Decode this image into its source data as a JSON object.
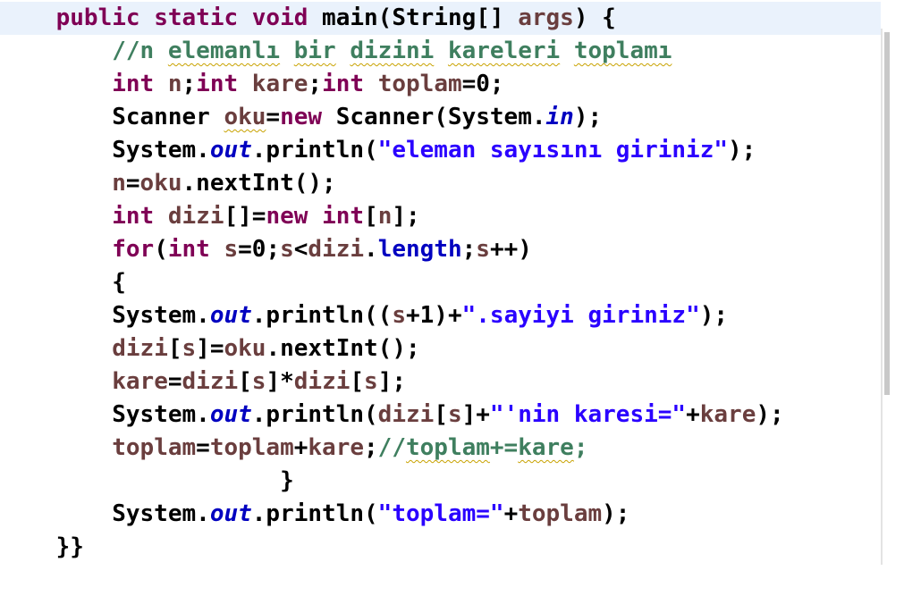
{
  "editor": {
    "lines": [
      [
        {
          "t": "    "
        },
        {
          "t": "public",
          "c": "kw"
        },
        {
          "t": " "
        },
        {
          "t": "static",
          "c": "kw"
        },
        {
          "t": " "
        },
        {
          "t": "void",
          "c": "kw"
        },
        {
          "t": " main(String[] "
        },
        {
          "t": "args",
          "c": "id"
        },
        {
          "t": ") {"
        }
      ],
      [
        {
          "t": "        "
        },
        {
          "t": "//n ",
          "c": "cmt"
        },
        {
          "t": "elemanlı",
          "c": "cmt sq"
        },
        {
          "t": " ",
          "c": "cmt"
        },
        {
          "t": "bir",
          "c": "cmt sq"
        },
        {
          "t": " ",
          "c": "cmt"
        },
        {
          "t": "dizini",
          "c": "cmt sq"
        },
        {
          "t": " ",
          "c": "cmt"
        },
        {
          "t": "kareleri",
          "c": "cmt sq"
        },
        {
          "t": " ",
          "c": "cmt"
        },
        {
          "t": "toplamı",
          "c": "cmt sq"
        }
      ],
      [
        {
          "t": "        "
        },
        {
          "t": "int",
          "c": "kw"
        },
        {
          "t": " "
        },
        {
          "t": "n",
          "c": "id"
        },
        {
          "t": ";"
        },
        {
          "t": "int",
          "c": "kw"
        },
        {
          "t": " "
        },
        {
          "t": "kare",
          "c": "id"
        },
        {
          "t": ";"
        },
        {
          "t": "int",
          "c": "kw"
        },
        {
          "t": " "
        },
        {
          "t": "toplam",
          "c": "id"
        },
        {
          "t": "=0;"
        }
      ],
      [
        {
          "t": "        Scanner "
        },
        {
          "t": "oku",
          "c": "id sq"
        },
        {
          "t": "="
        },
        {
          "t": "new",
          "c": "kw"
        },
        {
          "t": " Scanner(System."
        },
        {
          "t": "in",
          "c": "fld"
        },
        {
          "t": ");"
        }
      ],
      [
        {
          "t": "        System."
        },
        {
          "t": "out",
          "c": "fld"
        },
        {
          "t": ".println("
        },
        {
          "t": "\"eleman sayısını giriniz\"",
          "c": "str"
        },
        {
          "t": ");"
        }
      ],
      [
        {
          "t": "        "
        },
        {
          "t": "n",
          "c": "id"
        },
        {
          "t": "="
        },
        {
          "t": "oku",
          "c": "id"
        },
        {
          "t": ".nextInt();"
        }
      ],
      [
        {
          "t": "        "
        },
        {
          "t": "int",
          "c": "kw"
        },
        {
          "t": " "
        },
        {
          "t": "dizi",
          "c": "id"
        },
        {
          "t": "[]="
        },
        {
          "t": "new",
          "c": "kw"
        },
        {
          "t": " "
        },
        {
          "t": "int",
          "c": "kw"
        },
        {
          "t": "["
        },
        {
          "t": "n",
          "c": "id"
        },
        {
          "t": "];"
        }
      ],
      [
        {
          "t": "        "
        },
        {
          "t": "for",
          "c": "kw"
        },
        {
          "t": "("
        },
        {
          "t": "int",
          "c": "kw"
        },
        {
          "t": " "
        },
        {
          "t": "s",
          "c": "id"
        },
        {
          "t": "=0;"
        },
        {
          "t": "s",
          "c": "id"
        },
        {
          "t": "<"
        },
        {
          "t": "dizi",
          "c": "id"
        },
        {
          "t": "."
        },
        {
          "t": "length",
          "c": "fld2"
        },
        {
          "t": ";"
        },
        {
          "t": "s",
          "c": "id"
        },
        {
          "t": "++)"
        }
      ],
      [
        {
          "t": "        {"
        }
      ],
      [
        {
          "t": "        System."
        },
        {
          "t": "out",
          "c": "fld"
        },
        {
          "t": ".println(("
        },
        {
          "t": "s",
          "c": "id"
        },
        {
          "t": "+1)+"
        },
        {
          "t": "\".sayiyi giriniz\"",
          "c": "str"
        },
        {
          "t": ");"
        }
      ],
      [
        {
          "t": "        "
        },
        {
          "t": "dizi",
          "c": "id"
        },
        {
          "t": "["
        },
        {
          "t": "s",
          "c": "id"
        },
        {
          "t": "]="
        },
        {
          "t": "oku",
          "c": "id"
        },
        {
          "t": ".nextInt();"
        }
      ],
      [
        {
          "t": "        "
        },
        {
          "t": "kare",
          "c": "id"
        },
        {
          "t": "="
        },
        {
          "t": "dizi",
          "c": "id"
        },
        {
          "t": "["
        },
        {
          "t": "s",
          "c": "id"
        },
        {
          "t": "]*"
        },
        {
          "t": "dizi",
          "c": "id"
        },
        {
          "t": "["
        },
        {
          "t": "s",
          "c": "id"
        },
        {
          "t": "];"
        }
      ],
      [
        {
          "t": "        System."
        },
        {
          "t": "out",
          "c": "fld"
        },
        {
          "t": ".println("
        },
        {
          "t": "dizi",
          "c": "id"
        },
        {
          "t": "["
        },
        {
          "t": "s",
          "c": "id"
        },
        {
          "t": "]+"
        },
        {
          "t": "\"'nin karesi=\"",
          "c": "str"
        },
        {
          "t": "+"
        },
        {
          "t": "kare",
          "c": "id"
        },
        {
          "t": ");"
        }
      ],
      [
        {
          "t": "        "
        },
        {
          "t": "toplam",
          "c": "id"
        },
        {
          "t": "="
        },
        {
          "t": "toplam",
          "c": "id"
        },
        {
          "t": "+"
        },
        {
          "t": "kare",
          "c": "id"
        },
        {
          "t": ";"
        },
        {
          "t": "//",
          "c": "cmt"
        },
        {
          "t": "toplam",
          "c": "cmt sq"
        },
        {
          "t": "+=",
          "c": "cmt"
        },
        {
          "t": "kare",
          "c": "cmt sq"
        },
        {
          "t": ";",
          "c": "cmt"
        }
      ],
      [
        {
          "t": "                    }"
        }
      ],
      [
        {
          "t": "        System."
        },
        {
          "t": "out",
          "c": "fld"
        },
        {
          "t": ".println("
        },
        {
          "t": "\"toplam=\"",
          "c": "str"
        },
        {
          "t": "+"
        },
        {
          "t": "toplam",
          "c": "id"
        },
        {
          "t": ");"
        }
      ],
      [
        {
          "t": "    }}"
        }
      ]
    ]
  }
}
